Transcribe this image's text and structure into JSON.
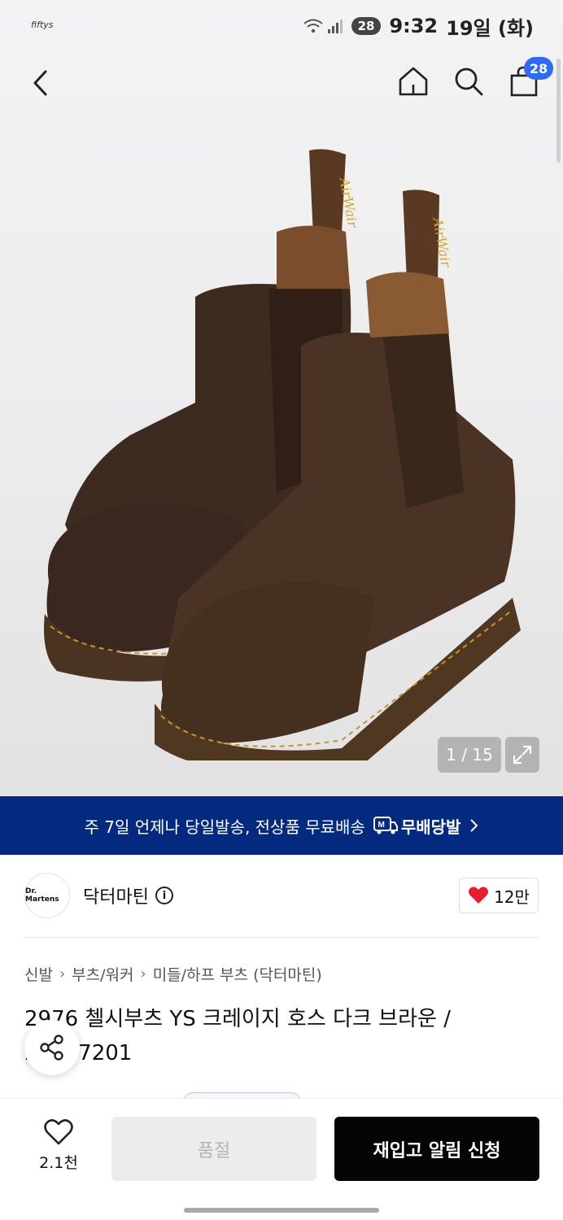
{
  "status_bar": {
    "app_logo": "fiftys",
    "battery": "28",
    "time": "9:32",
    "date": "19일 (화)"
  },
  "header": {
    "cart_count": "28"
  },
  "gallery": {
    "counter": "1 / 15"
  },
  "delivery_banner": {
    "text": "주 7일 언제나 당일발송, 전상품 무료배송",
    "badge_icon_letter": "M",
    "badge_label": "무배당발"
  },
  "brand": {
    "logo_text": "Dr. Martens",
    "name": "닥터마틴",
    "likes": "12만"
  },
  "breadcrumb": [
    "신발",
    "부츠/워커",
    "미들/하프 부츠 (닥터마틴)"
  ],
  "product": {
    "title": "2976 첼시부츠 YS 크레이지 호스 다크 브라운 / 22227201"
  },
  "bottom_bar": {
    "wish_count": "2.1천",
    "soldout_label": "품절",
    "restock_label": "재입고 알림 신청"
  },
  "colors": {
    "banner_bg": "#032a7f",
    "badge_blue": "#2f6bf2",
    "heart_red": "#e81d2d",
    "primary_btn": "#050505"
  }
}
